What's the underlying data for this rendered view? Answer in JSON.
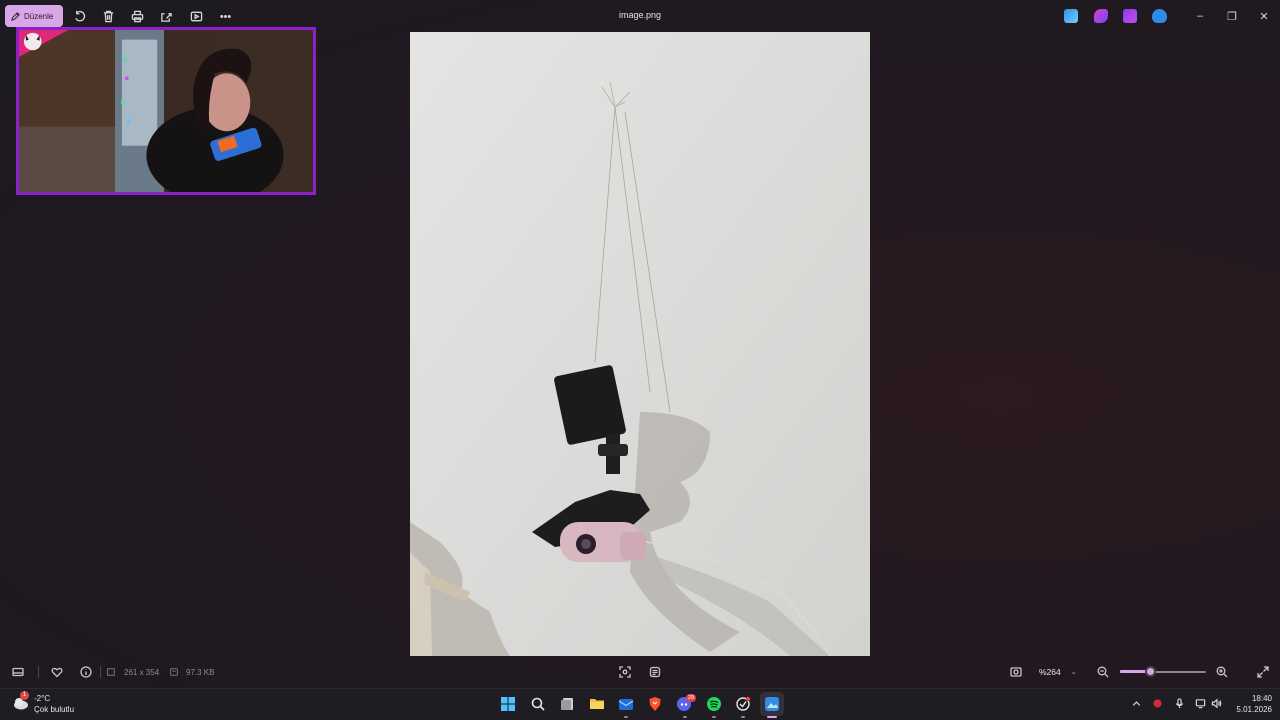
{
  "app": {
    "file_title": "image.png",
    "edit_label": "Düzenle",
    "accent": "#d7a7e6"
  },
  "toolbar": {
    "icons": [
      "rotate-icon",
      "delete-icon",
      "print-icon",
      "share-icon",
      "slideshow-icon",
      "more-icon"
    ]
  },
  "info": {
    "dimensions": "261 x 354",
    "file_size": "97.3 KB",
    "zoom_label": "%264",
    "zoom_level": 0.35
  },
  "taskbar": {
    "weather_temp": "-2°C",
    "weather_desc": "Çok bulutlu",
    "weather_badge": "1",
    "discord_badge": "29",
    "time": "18:40",
    "date": "5.01.2026"
  }
}
